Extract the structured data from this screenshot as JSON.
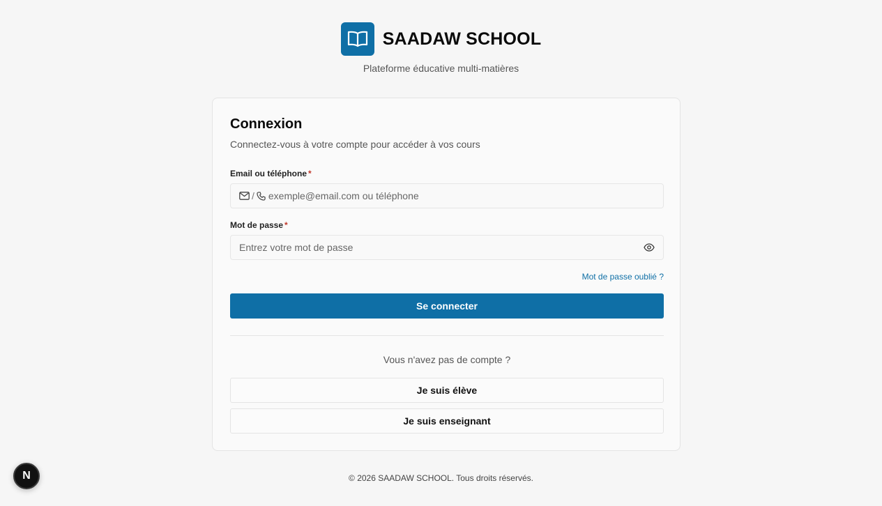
{
  "brand": {
    "name": "SAADAW SCHOOL",
    "tagline": "Plateforme éducative multi-matières",
    "accent_color": "#0f6fa6",
    "logo_icon": "open-book-icon"
  },
  "login": {
    "title": "Connexion",
    "subtitle": "Connectez-vous à votre compte pour accéder à vos cours",
    "identifier": {
      "label": "Email ou téléphone",
      "required_mark": "*",
      "prefix_separator": "/",
      "placeholder": "exemple@email.com ou téléphone",
      "value": ""
    },
    "password": {
      "label": "Mot de passe",
      "required_mark": "*",
      "placeholder": "Entrez votre mot de passe",
      "value": ""
    },
    "forgot_label": "Mot de passe oublié ?",
    "submit_label": "Se connecter",
    "no_account": "Vous n'avez pas de compte ?",
    "student_label": "Je suis élève",
    "teacher_label": "Je suis enseignant"
  },
  "footer": {
    "text": "© 2026 SAADAW SCHOOL. Tous droits réservés."
  },
  "dev_badge": {
    "letter": "N"
  }
}
